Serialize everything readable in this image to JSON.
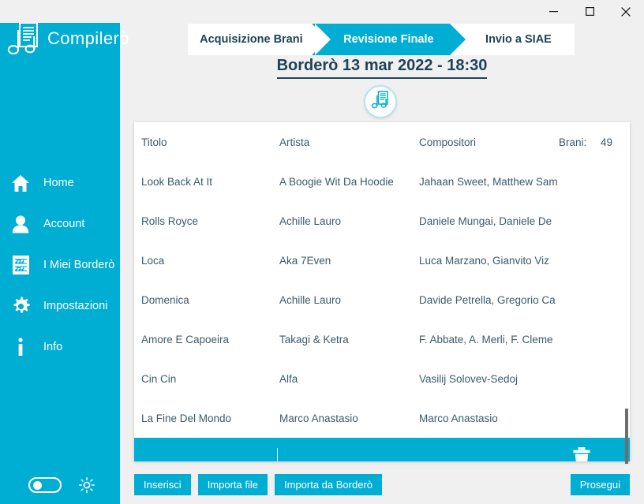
{
  "window": {
    "controls": [
      {
        "name": "minimize",
        "glyph": "minimize-icon"
      },
      {
        "name": "maximize",
        "glyph": "maximize-icon"
      },
      {
        "name": "close",
        "glyph": "close-icon"
      }
    ]
  },
  "brand": {
    "name": "Compilerò"
  },
  "sidebar": {
    "items": [
      {
        "label": "Home",
        "icon": "home-icon"
      },
      {
        "label": "Account",
        "icon": "person-icon"
      },
      {
        "label": "I Miei Borderò",
        "icon": "music-sheet-icon"
      },
      {
        "label": "Impostazioni",
        "icon": "gear-icon"
      },
      {
        "label": "Info",
        "icon": "info-icon"
      }
    ],
    "footer": {
      "theme_toggle": "theme-toggle",
      "brightness_icon": "sun-icon"
    }
  },
  "stepper": {
    "tabs": [
      {
        "label": "Acquisizione Brani",
        "active": false
      },
      {
        "label": "Revisione Finale",
        "active": true
      },
      {
        "label": "Invio a SIAE",
        "active": false
      }
    ]
  },
  "page": {
    "title": "Borderò 13 mar 2022 - 18:30",
    "badge_icon": "music-sheet-badge-icon"
  },
  "table": {
    "headers": {
      "title": "Titolo",
      "artist": "Artista",
      "composers": "Compositori",
      "count_label": "Brani:",
      "count_value": "49"
    },
    "rows": [
      {
        "title": "Look Back At It",
        "artist": "A Boogie Wit Da Hoodie",
        "composers": "Jahaan Sweet, Matthew Sam"
      },
      {
        "title": "Rolls Royce",
        "artist": "Achille Lauro",
        "composers": "Daniele Mungai, Daniele De"
      },
      {
        "title": "Loca",
        "artist": "Aka 7Even",
        "composers": "Luca Marzano, Gianvito Viz"
      },
      {
        "title": "Domenica",
        "artist": "Achille Lauro",
        "composers": "Davide Petrella, Gregorio Ca"
      },
      {
        "title": "Amore E Capoeira",
        "artist": "Takagi & Ketra",
        "composers": "F. Abbate, A. Merli, F. Cleme"
      },
      {
        "title": "Cin Cin",
        "artist": "Alfa",
        "composers": "Vasilij Solovev-Sedoj"
      },
      {
        "title": "La Fine Del Mondo",
        "artist": "Marco Anastasio",
        "composers": "Marco Anastasio"
      }
    ],
    "new_row": {
      "title": "",
      "artist": "",
      "composers": "",
      "delete_icon": "trash-icon"
    }
  },
  "actions": {
    "insert": "Inserisci",
    "import_file": "Importa file",
    "import_bordero": "Importa da Borderò",
    "continue": "Prosegui"
  },
  "colors": {
    "accent": "#00aed4",
    "text_dark": "#1d4356",
    "table_text": "#3b5a6b",
    "window_bg": "#f0f0f0"
  }
}
